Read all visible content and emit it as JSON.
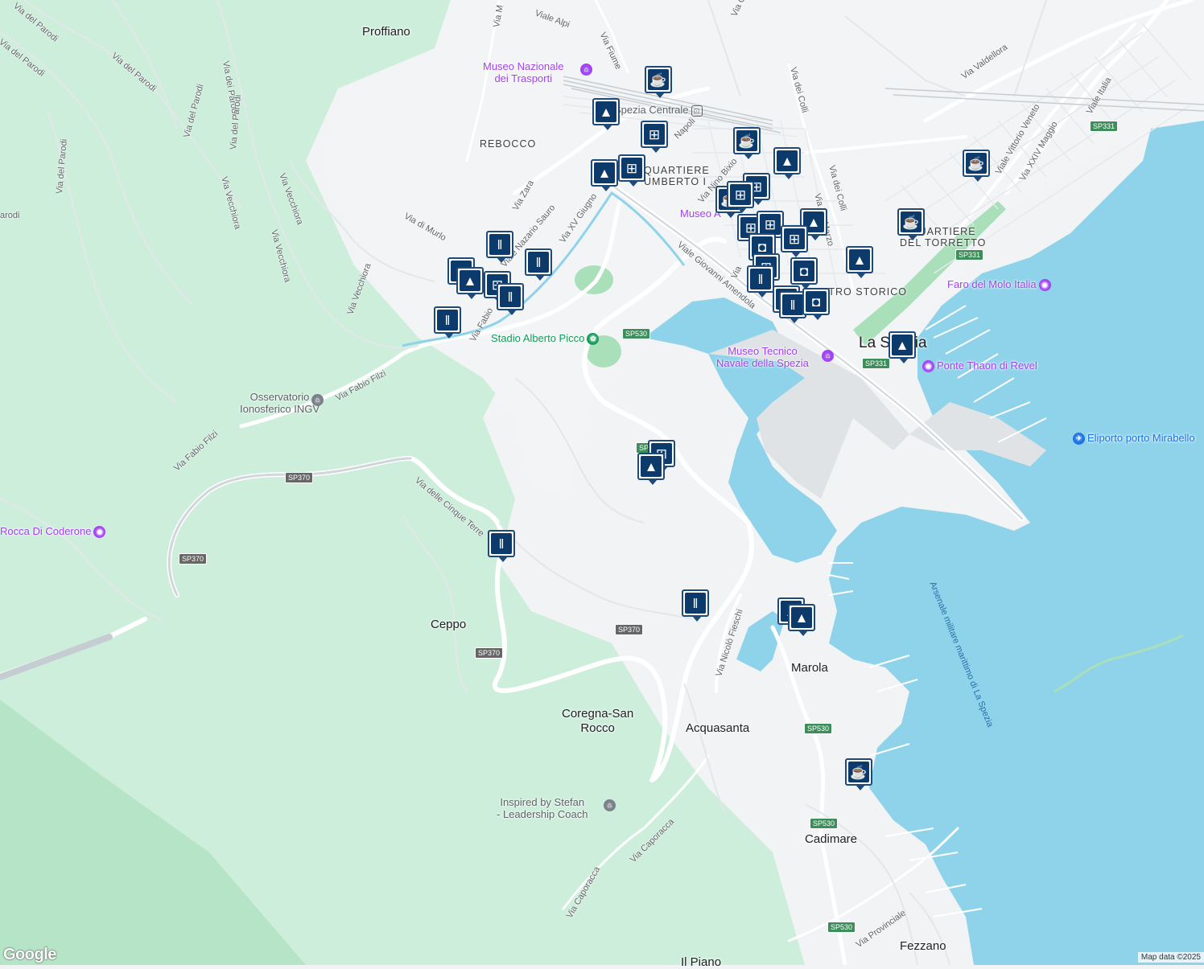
{
  "map": {
    "colors": {
      "water": "#8fd3ea",
      "land": "#f1f3f4",
      "park": "#cdeedb",
      "park_dark": "#b5e5c6",
      "road": "#ffffff",
      "marker_border": "#1e4a7a",
      "marker_fill": "#0b3a6b",
      "poi_purple": "#a142f4"
    },
    "places": {
      "proffiano": "Proffiano",
      "ceppo": "Ceppo",
      "coregna": "Coregna-San\nRocco",
      "acquasanta": "Acquasanta",
      "marola": "Marola",
      "cadimare": "Cadimare",
      "fezzano": "Fezzano",
      "il_piano": "Il Piano",
      "la_spezia": "La Spezia",
      "rebocco": "REBOCCO",
      "quartiere_umberto": "QUARTIERE\nUMBERTO I",
      "quartiere_torretto": "QUARTIERE\nDEL TORRETTO",
      "centro_storico": "CENTRO STORICO"
    },
    "pois": {
      "museo_trasporti": "Museo Nazionale\ndei Trasporti",
      "spezia_centrale": "Spezia Centrale",
      "museo_short": "Museo A",
      "faro_molo": "Faro del Molo Italia",
      "stadio": "Stadio Alberto Picco",
      "museo_tecnico": "Museo Tecnico\nNavale della Spezia",
      "ponte_thaon": "Ponte Thaon di Revel",
      "eliporto": "Eliporto porto Mirabello",
      "osservatorio": "Osservatorio\nIonosferico INGV",
      "rocca": "Rocca Di Coderone",
      "inspired": "Inspired by Stefan\n- Leadership Coach"
    },
    "streets": {
      "via_del_parodi_1": "Via del Parodi",
      "via_del_parodi_2": "Via del Parodi",
      "via_del_parodi_3": "Via del Parodi",
      "via_del_parodi_4": "Via del Parodi",
      "via_del_parodi_5": "Via del Parodi",
      "via_del_parodi_6": "Via del Parodi",
      "via_dei_parodi": "Via dei Parodi",
      "parodi_stub": "arodi",
      "via_vecchiora_1": "Via Vecchiora",
      "via_vecchiora_2": "Via Vecchiora",
      "via_vecchiora_3": "Via Vecchiora",
      "via_vecchiora_4": "Via Vecchiora",
      "via_di_murlo": "Via di Murlo",
      "via_zara": "Via Zara",
      "viale_nazario_sauro": "Viale Nazario Sauro",
      "via_xv_giugno": "Via XV Giugno",
      "via_fabio_filzi_1": "Via Fabio Filzi",
      "via_fabio_filzi_2": "Via Fabio Filzi",
      "via_fabio_filzi_3": "Via Fabio",
      "via_fiume": "Via Fiume",
      "viale_alpi": "Viale Alpi",
      "via_m": "Via M",
      "via_dei_colli_1": "Via dei Colli",
      "via_dei_colli_2": "Via dei Colli",
      "via_valdellora": "Via Valdellora",
      "viale_vittorio_veneto": "Viale Vittorio Veneto",
      "via_xxiv_maggio": "Via XXIV Maggio",
      "viale_italia": "Viale Italia",
      "via_napoli": "Napoli",
      "via_nino_bixio": "Via Nino Bixio",
      "via_xx_marzo": "Via XX Marzo",
      "viale_giovanni_amendola": "Viale Giovanni Amendola",
      "via_delle_cinque_terre": "Via delle Cinque Terre",
      "via_nicolo_fieschi": "Via Nicolò Fieschi",
      "via_caporacca_1": "Via Caporacca",
      "via_caporacca_2": "Via Caporacca",
      "via_provinciale": "Via Provinciale",
      "arsenale": "Arsenale militare marittimo di La Spezia",
      "via_c": "Via C",
      "via_short": "Via"
    },
    "badges": {
      "sp370_a": "SP370",
      "sp370_b": "SP370",
      "sp370_c": "SP370",
      "sp370_d": "SP370",
      "sp530_a": "SP530",
      "sp530_b": "SP530",
      "sp530_c": "SP530",
      "sp530_d": "SP530",
      "sp530_e": "SP530",
      "sp331_a": "SP331",
      "sp331_b": "SP331",
      "sp331_c": "SP331"
    },
    "attribution": {
      "logo": "Google",
      "credit": "Map data ©2025"
    }
  },
  "markers": [
    {
      "type": "cafe",
      "icon": "coffee-cup-icon"
    },
    {
      "type": "school",
      "icon": "graduation-cap-icon"
    },
    {
      "type": "shop",
      "icon": "shopping-cart-icon"
    },
    {
      "type": "restaurant",
      "icon": "fork-knife-icon"
    },
    {
      "type": "shopping",
      "icon": "shopping-bag-icon"
    }
  ]
}
